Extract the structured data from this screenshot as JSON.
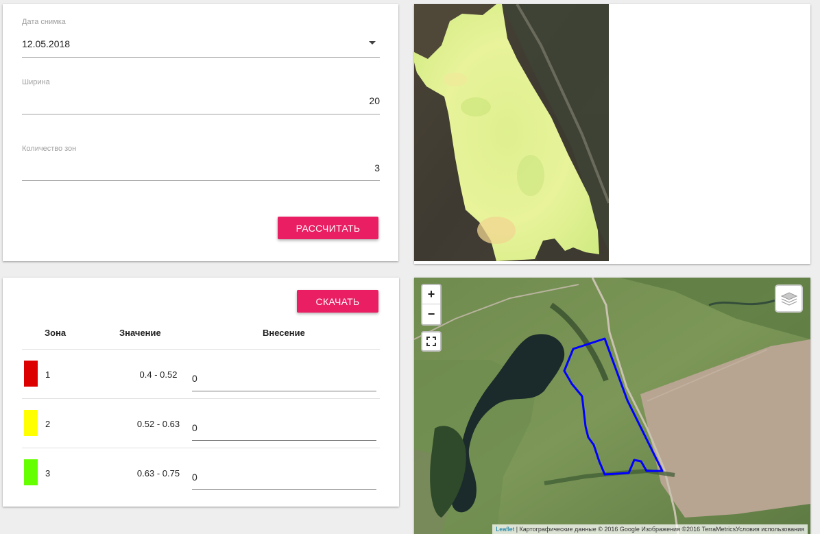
{
  "settings": {
    "date_label": "Дата снимка",
    "date_value": "12.05.2018",
    "width_label": "Ширина",
    "width_value": "20",
    "zones_label": "Количество зон",
    "zones_value": "3",
    "calc_button": "РАССЧИТАТЬ"
  },
  "zones_table": {
    "download_button": "СКАЧАТЬ",
    "columns": [
      "Зона",
      "Значение",
      "Внесение"
    ],
    "rows": [
      {
        "zone": "1",
        "range": "0.4 - 0.52",
        "application": "0",
        "color": "#dd0000"
      },
      {
        "zone": "2",
        "range": "0.52 - 0.63",
        "application": "0",
        "color": "#ffff00"
      },
      {
        "zone": "3",
        "range": "0.63 - 0.75",
        "application": "0",
        "color": "#66ff00"
      }
    ]
  },
  "map": {
    "zoom_in": "+",
    "zoom_out": "−",
    "attribution_link": "Leaflet",
    "attribution_text": " | Картографические данные © 2016 Google Изображения ©2016 TerraMetricsУсловия использования",
    "field_outline_color": "#0000ff"
  }
}
